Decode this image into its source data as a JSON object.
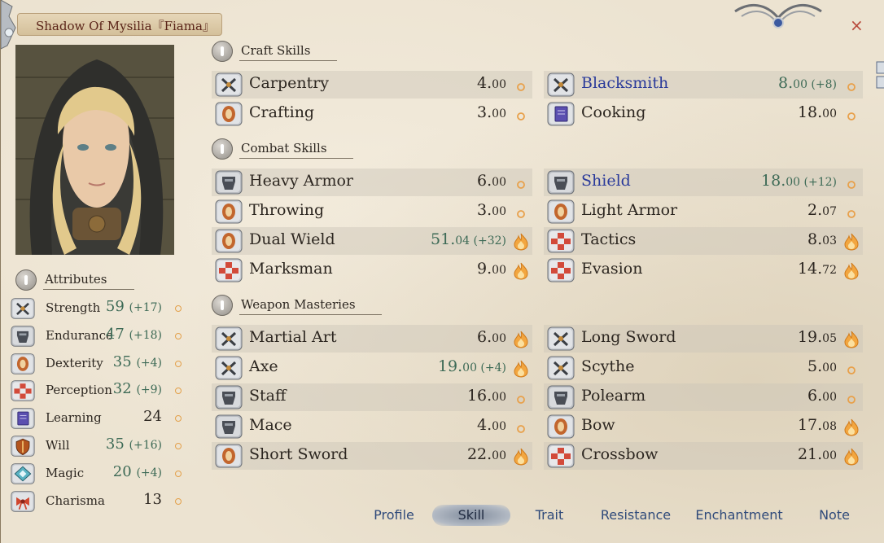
{
  "window": {
    "title": "Shadow Of Mysilia『Fiama』",
    "close_label": "×"
  },
  "attributes": {
    "header": "Attributes",
    "items": [
      {
        "label": "Strength",
        "value": "59",
        "bonus": "(+17)",
        "icon": "crossed-swords-icon"
      },
      {
        "label": "Endurance",
        "value": "47",
        "bonus": "(+18)",
        "icon": "armor-icon"
      },
      {
        "label": "Dexterity",
        "value": "35",
        "bonus": "(+4)",
        "icon": "hand-icon"
      },
      {
        "label": "Perception",
        "value": "32",
        "bonus": "(+9)",
        "icon": "eye-tiles-icon"
      },
      {
        "label": "Learning",
        "value": "24",
        "bonus": "",
        "icon": "book-icon"
      },
      {
        "label": "Will",
        "value": "35",
        "bonus": "(+16)",
        "icon": "will-shield-icon"
      },
      {
        "label": "Magic",
        "value": "20",
        "bonus": "(+4)",
        "icon": "magic-rune-icon"
      },
      {
        "label": "Charisma",
        "value": "13",
        "bonus": "",
        "icon": "ribbon-icon"
      }
    ]
  },
  "sections": [
    {
      "title": "Craft Skills",
      "rows": [
        [
          {
            "label": "Carpentry",
            "value": "4.",
            "dec": "00",
            "bonus": "",
            "icon": "crossed-swords-icon",
            "potential": "low"
          },
          {
            "label": "Blacksmith",
            "value": "8.",
            "dec": "00",
            "bonus": " (+8)",
            "icon": "crossed-swords-icon",
            "potential": "low",
            "highlight": true
          }
        ],
        [
          {
            "label": "Crafting",
            "value": "3.",
            "dec": "00",
            "bonus": "",
            "icon": "hand-icon",
            "potential": "low"
          },
          {
            "label": "Cooking",
            "value": "18.",
            "dec": "00",
            "bonus": "",
            "icon": "book-icon",
            "potential": "low"
          }
        ]
      ]
    },
    {
      "title": "Combat Skills",
      "rows": [
        [
          {
            "label": "Heavy Armor",
            "value": "6.",
            "dec": "00",
            "bonus": "",
            "icon": "armor-icon",
            "potential": "low"
          },
          {
            "label": "Shield",
            "value": "18.",
            "dec": "00",
            "bonus": " (+12)",
            "icon": "armor-icon",
            "potential": "low",
            "highlight": true
          }
        ],
        [
          {
            "label": "Throwing",
            "value": "3.",
            "dec": "00",
            "bonus": "",
            "icon": "hand-icon",
            "potential": "low"
          },
          {
            "label": "Light Armor",
            "value": "2.",
            "dec": "07",
            "bonus": "",
            "icon": "hand-icon",
            "potential": "low"
          }
        ],
        [
          {
            "label": "Dual Wield",
            "value": "51.",
            "dec": "04",
            "bonus": " (+32)",
            "icon": "hand-icon",
            "potential": "high"
          },
          {
            "label": "Tactics",
            "value": "8.",
            "dec": "03",
            "bonus": "",
            "icon": "eye-tiles-icon",
            "potential": "high"
          }
        ],
        [
          {
            "label": "Marksman",
            "value": "9.",
            "dec": "00",
            "bonus": "",
            "icon": "eye-tiles-icon",
            "potential": "high"
          },
          {
            "label": "Evasion",
            "value": "14.",
            "dec": "72",
            "bonus": "",
            "icon": "eye-tiles-icon",
            "potential": "high"
          }
        ]
      ]
    },
    {
      "title": "Weapon Masteries",
      "rows": [
        [
          {
            "label": "Martial Art",
            "value": "6.",
            "dec": "00",
            "bonus": "",
            "icon": "crossed-swords-icon",
            "potential": "high"
          },
          {
            "label": "Long Sword",
            "value": "19.",
            "dec": "05",
            "bonus": "",
            "icon": "crossed-swords-icon",
            "potential": "high"
          }
        ],
        [
          {
            "label": "Axe",
            "value": "19.",
            "dec": "00",
            "bonus": " (+4)",
            "icon": "crossed-swords-icon",
            "potential": "high"
          },
          {
            "label": "Scythe",
            "value": "5.",
            "dec": "00",
            "bonus": "",
            "icon": "crossed-swords-icon",
            "potential": "low"
          }
        ],
        [
          {
            "label": "Staff",
            "value": "16.",
            "dec": "00",
            "bonus": "",
            "icon": "armor-icon",
            "potential": "low"
          },
          {
            "label": "Polearm",
            "value": "6.",
            "dec": "00",
            "bonus": "",
            "icon": "armor-icon",
            "potential": "low"
          }
        ],
        [
          {
            "label": "Mace",
            "value": "4.",
            "dec": "00",
            "bonus": "",
            "icon": "armor-icon",
            "potential": "low"
          },
          {
            "label": "Bow",
            "value": "17.",
            "dec": "08",
            "bonus": "",
            "icon": "hand-icon",
            "potential": "high"
          }
        ],
        [
          {
            "label": "Short Sword",
            "value": "22.",
            "dec": "00",
            "bonus": "",
            "icon": "hand-icon",
            "potential": "high"
          },
          {
            "label": "Crossbow",
            "value": "21.",
            "dec": "00",
            "bonus": "",
            "icon": "eye-tiles-icon",
            "potential": "high"
          }
        ]
      ]
    }
  ],
  "tabs": [
    {
      "label": "Profile",
      "active": false
    },
    {
      "label": "Skill",
      "active": true
    },
    {
      "label": "Trait",
      "active": false
    },
    {
      "label": "Resistance",
      "active": false
    },
    {
      "label": "Enchantment",
      "active": false
    },
    {
      "label": "Note",
      "active": false
    }
  ],
  "colors": {
    "panel": "#ece3d1",
    "bonus_green": "#3d6a56",
    "highlight_blue": "#2a3a9a",
    "title_red": "#5a2418"
  }
}
